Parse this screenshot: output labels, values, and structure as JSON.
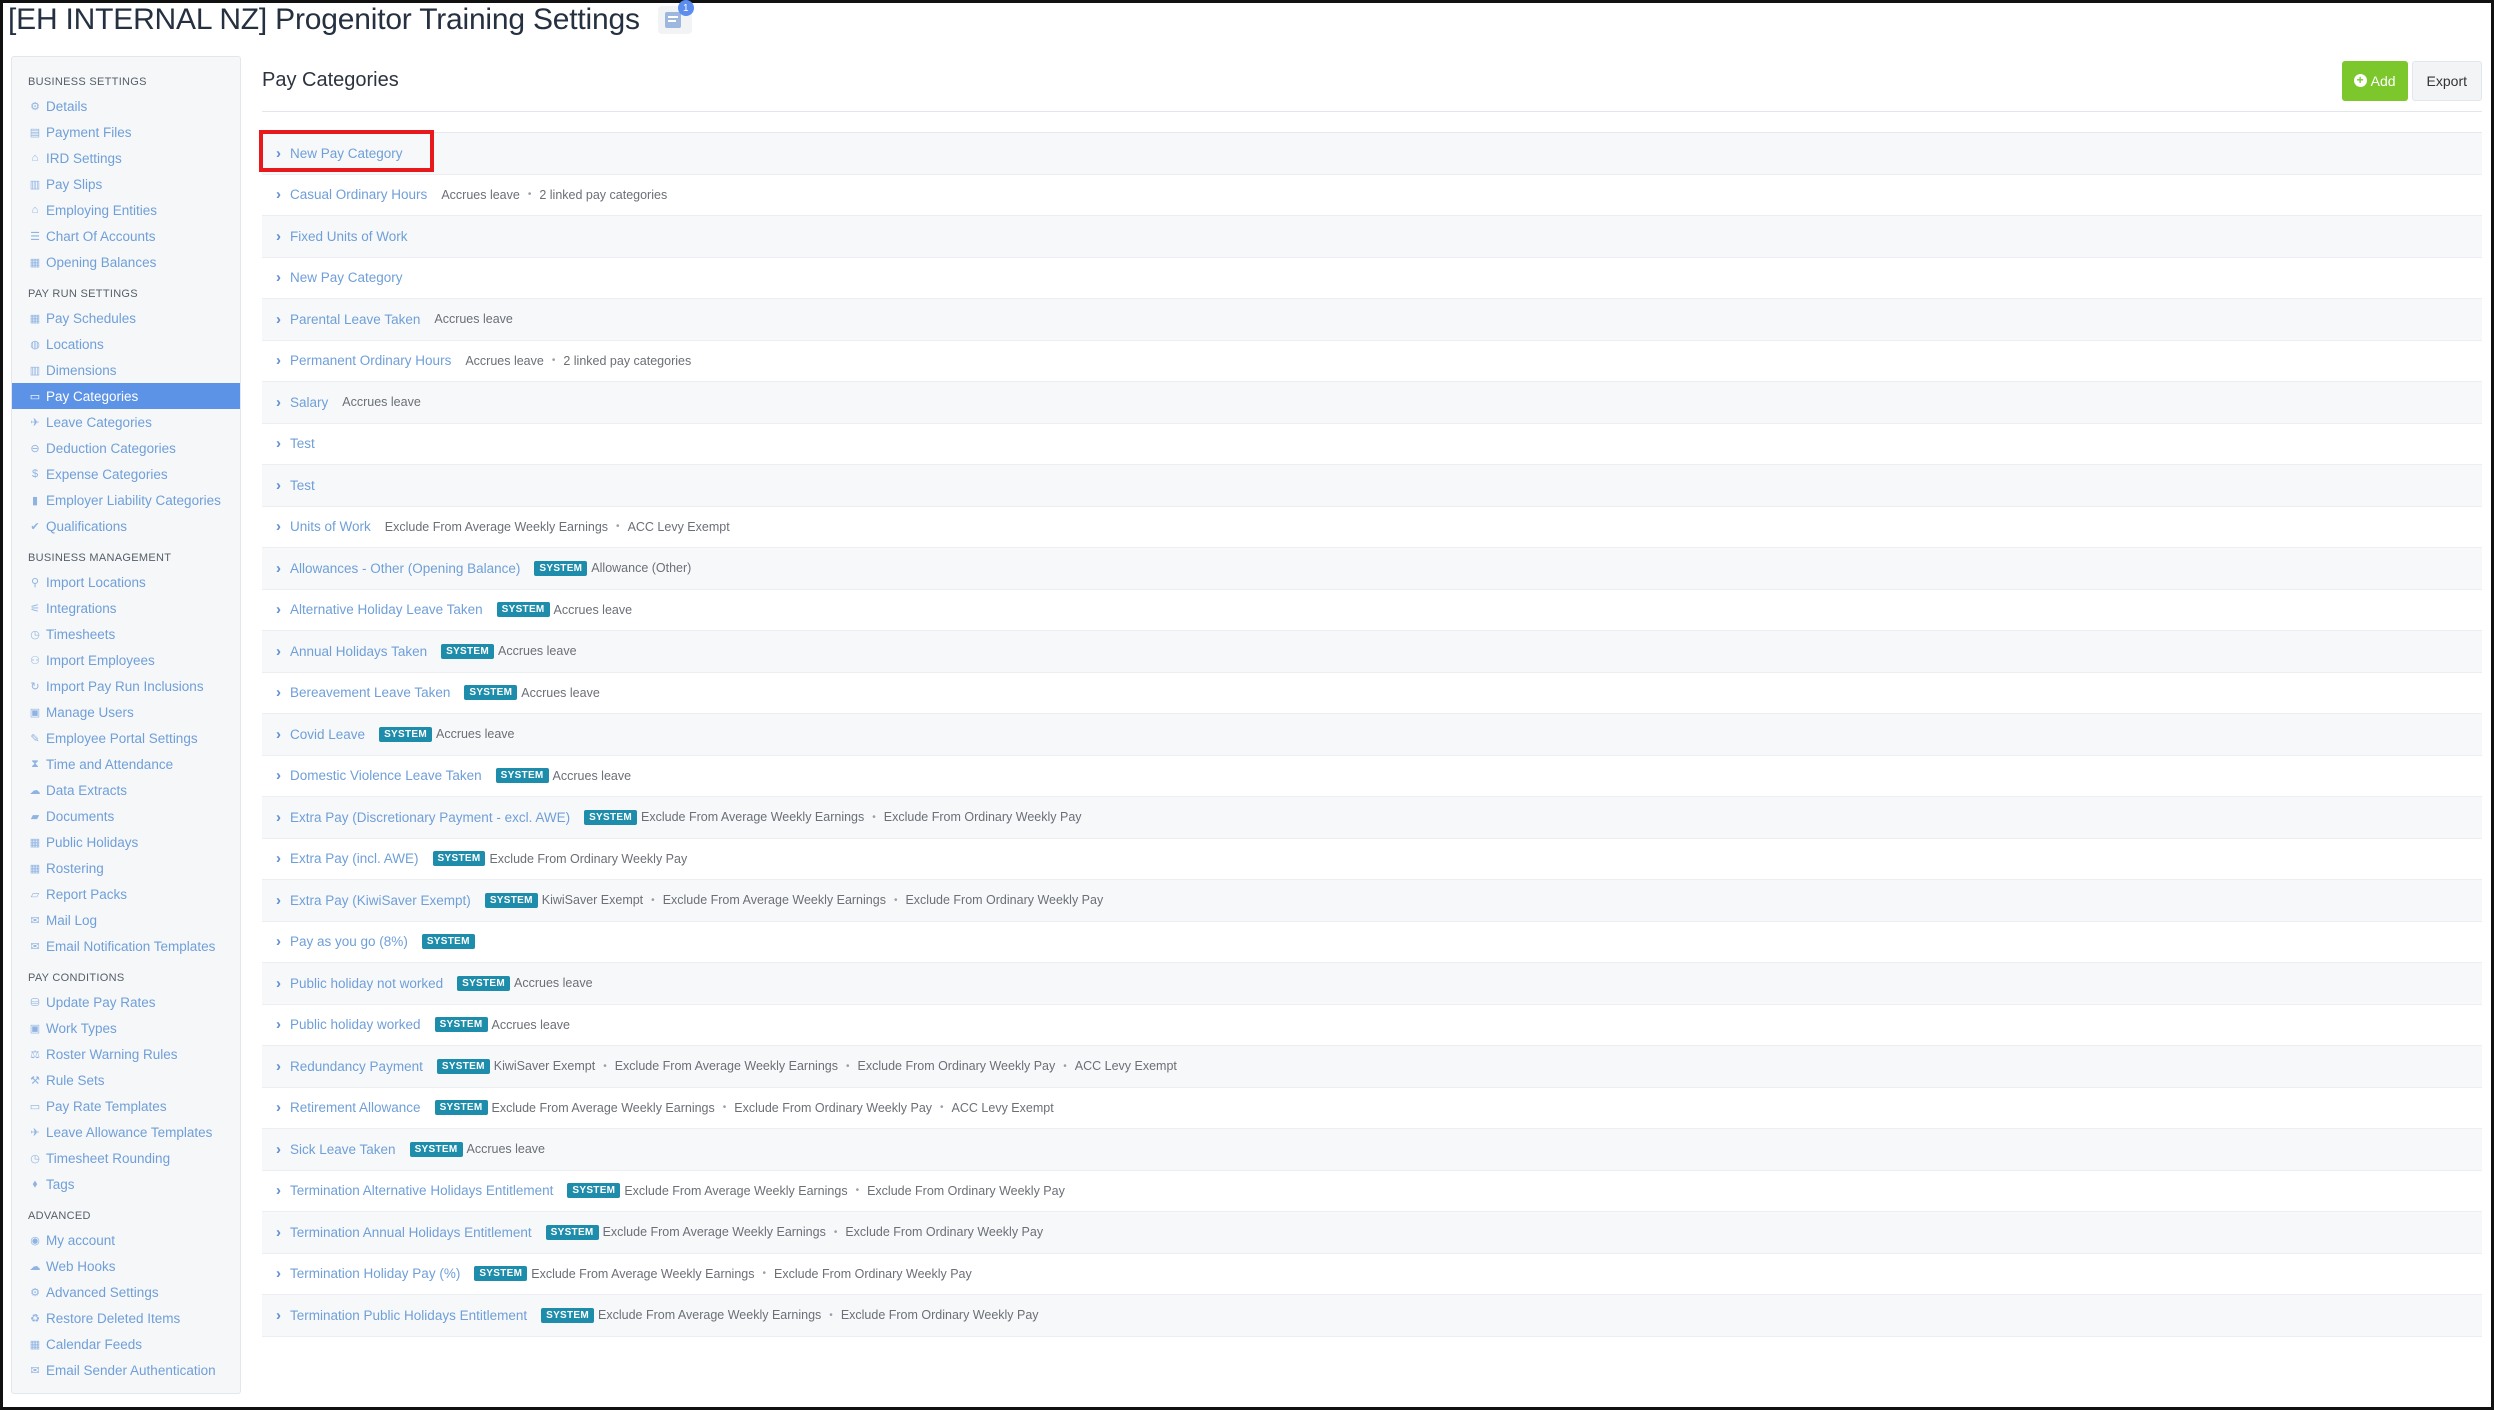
{
  "title": "[EH INTERNAL NZ] Progenitor Training Settings",
  "notes_badge": "1",
  "sidebar": {
    "sections": [
      {
        "heading": "BUSINESS SETTINGS",
        "items": [
          {
            "label": "Details",
            "icon": "gear-icon",
            "glyph": "⚙"
          },
          {
            "label": "Payment Files",
            "icon": "file-icon",
            "glyph": "▤"
          },
          {
            "label": "IRD Settings",
            "icon": "building-icon",
            "glyph": "⌂"
          },
          {
            "label": "Pay Slips",
            "icon": "document-icon",
            "glyph": "▥"
          },
          {
            "label": "Employing Entities",
            "icon": "bank-icon",
            "glyph": "⌂"
          },
          {
            "label": "Chart Of Accounts",
            "icon": "list-icon",
            "glyph": "☰"
          },
          {
            "label": "Opening Balances",
            "icon": "ledger-icon",
            "glyph": "▦"
          }
        ]
      },
      {
        "heading": "PAY RUN SETTINGS",
        "items": [
          {
            "label": "Pay Schedules",
            "icon": "calendar-icon",
            "glyph": "▦"
          },
          {
            "label": "Locations",
            "icon": "globe-icon",
            "glyph": "◍"
          },
          {
            "label": "Dimensions",
            "icon": "chart-icon",
            "glyph": "▥"
          },
          {
            "label": "Pay Categories",
            "icon": "money-icon",
            "glyph": "▭",
            "active": true
          },
          {
            "label": "Leave Categories",
            "icon": "plane-icon",
            "glyph": "✈"
          },
          {
            "label": "Deduction Categories",
            "icon": "minus-circle-icon",
            "glyph": "⊖"
          },
          {
            "label": "Expense Categories",
            "icon": "dollar-circle-icon",
            "glyph": "$"
          },
          {
            "label": "Employer Liability Categories",
            "icon": "bar-chart-icon",
            "glyph": "▮"
          },
          {
            "label": "Qualifications",
            "icon": "check-icon",
            "glyph": "✔"
          }
        ]
      },
      {
        "heading": "BUSINESS MANAGEMENT",
        "items": [
          {
            "label": "Import Locations",
            "icon": "map-pin-icon",
            "glyph": "⚲"
          },
          {
            "label": "Integrations",
            "icon": "plug-icon",
            "glyph": "⚟"
          },
          {
            "label": "Timesheets",
            "icon": "clock-icon",
            "glyph": "◷"
          },
          {
            "label": "Import Employees",
            "icon": "people-icon",
            "glyph": "⚇"
          },
          {
            "label": "Import Pay Run Inclusions",
            "icon": "refresh-icon",
            "glyph": "↻"
          },
          {
            "label": "Manage Users",
            "icon": "lock-icon",
            "glyph": "▣"
          },
          {
            "label": "Employee Portal Settings",
            "icon": "brush-icon",
            "glyph": "✎"
          },
          {
            "label": "Time and Attendance",
            "icon": "hourglass-icon",
            "glyph": "⧗"
          },
          {
            "label": "Data Extracts",
            "icon": "cloud-download-icon",
            "glyph": "☁"
          },
          {
            "label": "Documents",
            "icon": "folder-icon",
            "glyph": "▰"
          },
          {
            "label": "Public Holidays",
            "icon": "calendar-icon",
            "glyph": "▦"
          },
          {
            "label": "Rostering",
            "icon": "calendar-icon",
            "glyph": "▦"
          },
          {
            "label": "Report Packs",
            "icon": "folder-open-icon",
            "glyph": "▱"
          },
          {
            "label": "Mail Log",
            "icon": "mail-icon",
            "glyph": "✉"
          },
          {
            "label": "Email Notification Templates",
            "icon": "mail-icon",
            "glyph": "✉"
          }
        ]
      },
      {
        "heading": "PAY CONDITIONS",
        "items": [
          {
            "label": "Update Pay Rates",
            "icon": "coins-icon",
            "glyph": "⛁"
          },
          {
            "label": "Work Types",
            "icon": "briefcase-icon",
            "glyph": "▣"
          },
          {
            "label": "Roster Warning Rules",
            "icon": "balance-icon",
            "glyph": "⚖"
          },
          {
            "label": "Rule Sets",
            "icon": "gavel-icon",
            "glyph": "⚒"
          },
          {
            "label": "Pay Rate Templates",
            "icon": "money-icon",
            "glyph": "▭"
          },
          {
            "label": "Leave Allowance Templates",
            "icon": "plane-icon",
            "glyph": "✈"
          },
          {
            "label": "Timesheet Rounding",
            "icon": "clock-icon",
            "glyph": "◷"
          },
          {
            "label": "Tags",
            "icon": "tag-icon",
            "glyph": "⬧"
          }
        ]
      },
      {
        "heading": "ADVANCED",
        "items": [
          {
            "label": "My account",
            "icon": "user-circle-icon",
            "glyph": "◉"
          },
          {
            "label": "Web Hooks",
            "icon": "cloud-icon",
            "glyph": "☁"
          },
          {
            "label": "Advanced Settings",
            "icon": "gear-icon",
            "glyph": "⚙"
          },
          {
            "label": "Restore Deleted Items",
            "icon": "recycle-icon",
            "glyph": "♻"
          },
          {
            "label": "Calendar Feeds",
            "icon": "calendar-icon",
            "glyph": "▦"
          },
          {
            "label": "Email Sender Authentication",
            "icon": "mail-icon",
            "glyph": "✉"
          }
        ]
      }
    ]
  },
  "main": {
    "heading": "Pay Categories",
    "add_label": "Add",
    "export_label": "Export",
    "system_label": "SYSTEM",
    "rows": [
      {
        "name": "New Pay Category",
        "system": false,
        "tags": []
      },
      {
        "name": "Casual Ordinary Hours",
        "system": false,
        "tags": [
          "Accrues leave",
          "2 linked pay categories"
        ]
      },
      {
        "name": "Fixed Units of Work",
        "system": false,
        "tags": []
      },
      {
        "name": "New Pay Category",
        "system": false,
        "tags": []
      },
      {
        "name": "Parental Leave Taken",
        "system": false,
        "tags": [
          "Accrues leave"
        ]
      },
      {
        "name": "Permanent Ordinary Hours",
        "system": false,
        "tags": [
          "Accrues leave",
          "2 linked pay categories"
        ]
      },
      {
        "name": "Salary",
        "system": false,
        "tags": [
          "Accrues leave"
        ]
      },
      {
        "name": "Test",
        "system": false,
        "tags": []
      },
      {
        "name": "Test",
        "system": false,
        "tags": []
      },
      {
        "name": "Units of Work",
        "system": false,
        "tags": [
          "Exclude From Average Weekly Earnings",
          "ACC Levy Exempt"
        ]
      },
      {
        "name": "Allowances - Other (Opening Balance)",
        "system": true,
        "tags": [
          "Allowance (Other)"
        ]
      },
      {
        "name": "Alternative Holiday Leave Taken",
        "system": true,
        "tags": [
          "Accrues leave"
        ]
      },
      {
        "name": "Annual Holidays Taken",
        "system": true,
        "tags": [
          "Accrues leave"
        ]
      },
      {
        "name": "Bereavement Leave Taken",
        "system": true,
        "tags": [
          "Accrues leave"
        ]
      },
      {
        "name": "Covid Leave",
        "system": true,
        "tags": [
          "Accrues leave"
        ]
      },
      {
        "name": "Domestic Violence Leave Taken",
        "system": true,
        "tags": [
          "Accrues leave"
        ]
      },
      {
        "name": "Extra Pay (Discretionary Payment - excl. AWE)",
        "system": true,
        "tags": [
          "Exclude From Average Weekly Earnings",
          "Exclude From Ordinary Weekly Pay"
        ]
      },
      {
        "name": "Extra Pay (incl. AWE)",
        "system": true,
        "tags": [
          "Exclude From Ordinary Weekly Pay"
        ]
      },
      {
        "name": "Extra Pay (KiwiSaver Exempt)",
        "system": true,
        "tags": [
          "KiwiSaver Exempt",
          "Exclude From Average Weekly Earnings",
          "Exclude From Ordinary Weekly Pay"
        ]
      },
      {
        "name": "Pay as you go (8%)",
        "system": true,
        "tags": []
      },
      {
        "name": "Public holiday not worked",
        "system": true,
        "tags": [
          "Accrues leave"
        ]
      },
      {
        "name": "Public holiday worked",
        "system": true,
        "tags": [
          "Accrues leave"
        ]
      },
      {
        "name": "Redundancy Payment",
        "system": true,
        "tags": [
          "KiwiSaver Exempt",
          "Exclude From Average Weekly Earnings",
          "Exclude From Ordinary Weekly Pay",
          "ACC Levy Exempt"
        ]
      },
      {
        "name": "Retirement Allowance",
        "system": true,
        "tags": [
          "Exclude From Average Weekly Earnings",
          "Exclude From Ordinary Weekly Pay",
          "ACC Levy Exempt"
        ]
      },
      {
        "name": "Sick Leave Taken",
        "system": true,
        "tags": [
          "Accrues leave"
        ]
      },
      {
        "name": "Termination Alternative Holidays Entitlement",
        "system": true,
        "tags": [
          "Exclude From Average Weekly Earnings",
          "Exclude From Ordinary Weekly Pay"
        ]
      },
      {
        "name": "Termination Annual Holidays Entitlement",
        "system": true,
        "tags": [
          "Exclude From Average Weekly Earnings",
          "Exclude From Ordinary Weekly Pay"
        ]
      },
      {
        "name": "Termination Holiday Pay (%)",
        "system": true,
        "tags": [
          "Exclude From Average Weekly Earnings",
          "Exclude From Ordinary Weekly Pay"
        ]
      },
      {
        "name": "Termination Public Holidays Entitlement",
        "system": true,
        "tags": [
          "Exclude From Average Weekly Earnings",
          "Exclude From Ordinary Weekly Pay"
        ]
      }
    ]
  },
  "colors": {
    "link": "#6f9fd8",
    "active": "#5c93e6",
    "add_button": "#7cc72c",
    "system_badge": "#1e8dab",
    "highlight": "#e8191c"
  }
}
